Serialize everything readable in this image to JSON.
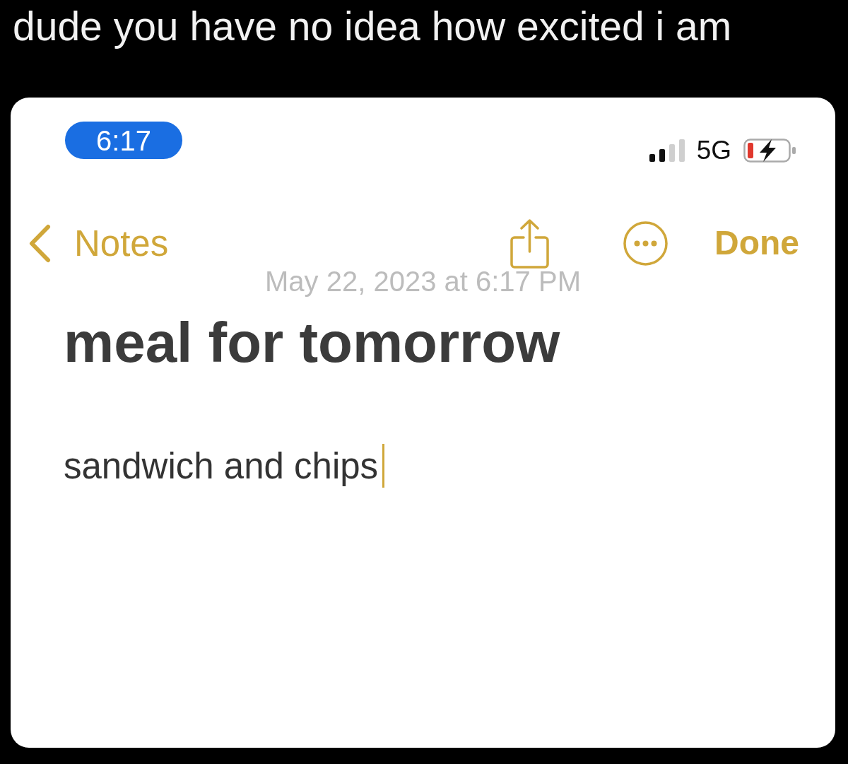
{
  "caption": "dude you have no idea how excited i am",
  "status_bar": {
    "time": "6:17",
    "network": "5G"
  },
  "nav": {
    "back": "Notes",
    "done": "Done"
  },
  "note": {
    "date": "May 22, 2023 at 6:17 PM",
    "title": "meal for tomorrow",
    "body": "sandwich and chips"
  }
}
